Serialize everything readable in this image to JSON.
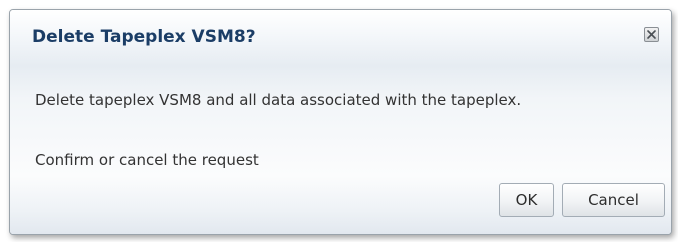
{
  "dialog": {
    "title": "Delete Tapeplex VSM8?",
    "close_icon": "close-x-icon",
    "message": "Delete tapeplex VSM8 and all data associated with the tapeplex.",
    "prompt": "Confirm or cancel the request",
    "ok_label": "OK",
    "cancel_label": "Cancel"
  },
  "colors": {
    "title": "#1b3d66",
    "text": "#333333",
    "border": "#9aa3ab"
  }
}
